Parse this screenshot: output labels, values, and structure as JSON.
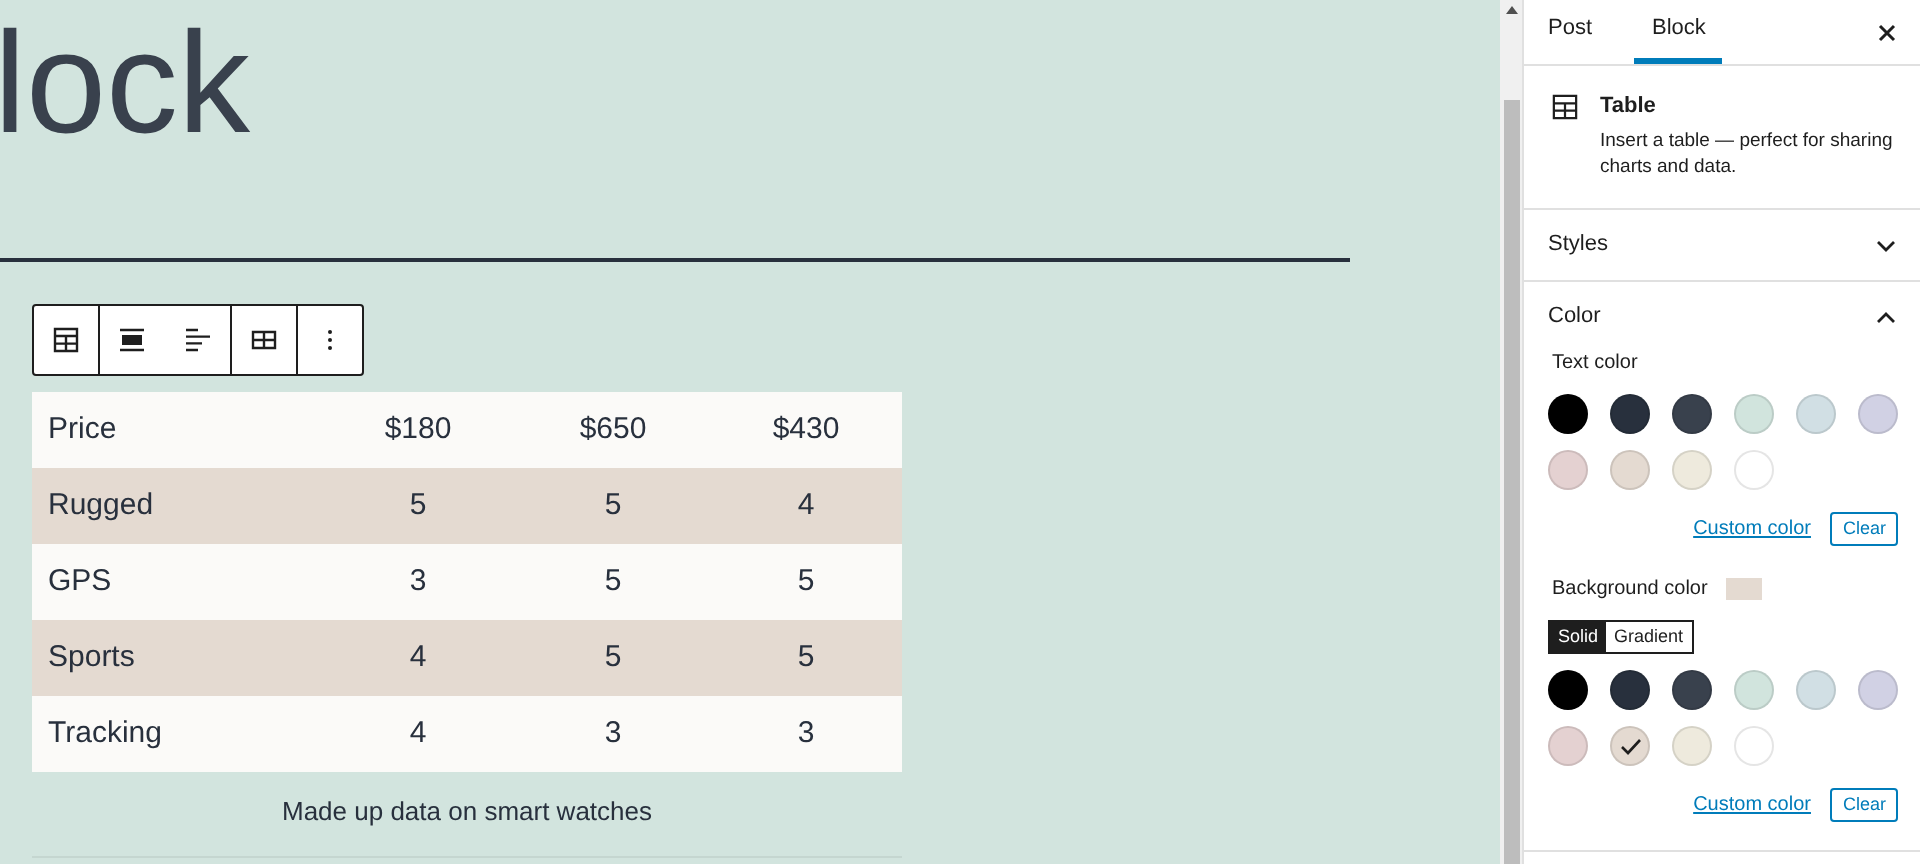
{
  "editor": {
    "title": "lock",
    "toolbar": [
      {
        "kind": "table"
      },
      {
        "kind": "align-wide"
      },
      {
        "kind": "align-left"
      },
      {
        "kind": "table-edit"
      },
      {
        "kind": "more"
      }
    ],
    "table": {
      "rows": [
        {
          "cells": [
            "Price",
            "$180",
            "$650",
            "$430"
          ]
        },
        {
          "cells": [
            "Rugged",
            "5",
            "5",
            "4"
          ]
        },
        {
          "cells": [
            "GPS",
            "3",
            "5",
            "5"
          ]
        },
        {
          "cells": [
            "Sports",
            "4",
            "5",
            "5"
          ]
        },
        {
          "cells": [
            "Tracking",
            "4",
            "3",
            "3"
          ]
        }
      ],
      "caption": "Made up data on smart watches"
    }
  },
  "sidebar": {
    "tabs": [
      {
        "label": "Post",
        "selected": false
      },
      {
        "label": "Block",
        "selected": true
      }
    ],
    "block": {
      "name": "Table",
      "description": "Insert a table — perfect for sharing charts and data."
    },
    "panels": [
      {
        "title": "Styles",
        "expanded": false
      },
      {
        "title": "Color",
        "expanded": true
      }
    ],
    "text_color": {
      "label": "Text color",
      "swatches": [
        {
          "color": "#000000",
          "selected": false
        },
        {
          "color": "#28303d",
          "selected": false
        },
        {
          "color": "#39414d",
          "selected": false
        },
        {
          "color": "#d1e4dd",
          "selected": false
        },
        {
          "color": "#d1dfe4",
          "selected": false
        },
        {
          "color": "#d1d1e4",
          "selected": false
        },
        {
          "color": "#e4d1d1",
          "selected": false
        },
        {
          "color": "#e4dad1",
          "selected": false
        },
        {
          "color": "#eeeadd",
          "selected": false
        },
        {
          "color": "#ffffff",
          "selected": false
        }
      ],
      "custom_link": "Custom color",
      "clear_button": "Clear"
    },
    "background_color": {
      "label": "Background color",
      "color": "#e4dad1",
      "modes": [
        {
          "label": "Solid",
          "selected": true
        },
        {
          "label": "Gradient",
          "selected": false
        }
      ],
      "swatches": [
        {
          "color": "#000000",
          "selected": false
        },
        {
          "color": "#28303d",
          "selected": false
        },
        {
          "color": "#39414d",
          "selected": false
        },
        {
          "color": "#d1e4dd",
          "selected": false
        },
        {
          "color": "#d1dfe4",
          "selected": false
        },
        {
          "color": "#d1d1e4",
          "selected": false
        },
        {
          "color": "#e4d1d1",
          "selected": false
        },
        {
          "color": "#e4dad1",
          "selected": true
        },
        {
          "color": "#eeeadd",
          "selected": false
        },
        {
          "color": "#ffffff",
          "selected": false
        }
      ],
      "custom_link": "Custom color",
      "clear_button": "Clear"
    }
  }
}
